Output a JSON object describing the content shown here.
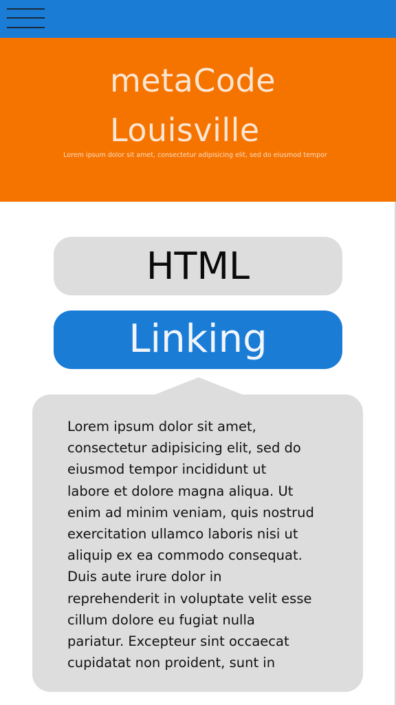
{
  "app": {
    "menu_icon": "hamburger-menu-icon",
    "colors": {
      "nav_bar": "#1b7cd6",
      "hero_background": "#f57400",
      "hero_text": "#fbe6d4",
      "button_default": "#dddddd",
      "button_active": "#1b7cd6",
      "bubble_background": "#dddddd"
    }
  },
  "hero": {
    "title_line1": "metaCode",
    "title_line2": "Louisville",
    "subtitle": "Lorem ipsum dolor sit amet, consectetur adipisicing elit, sed do eiusmod tempor"
  },
  "topics": {
    "html_label": "HTML",
    "linking_label": "Linking",
    "active": "Linking"
  },
  "description": {
    "text": "Lorem ipsum dolor sit amet,\nconsectetur adipisicing elit, sed do\neiusmod tempor incididunt ut\nlabore et dolore magna aliqua. Ut\nenim ad minim veniam, quis nostrud\nexercitation ullamco laboris nisi ut\naliquip ex ea commodo consequat.\nDuis aute irure dolor in\nreprehenderit in voluptate velit esse\ncillum dolore eu fugiat nulla\npariatur. Excepteur sint occaecat\ncupidatat non proident, sunt in"
  }
}
